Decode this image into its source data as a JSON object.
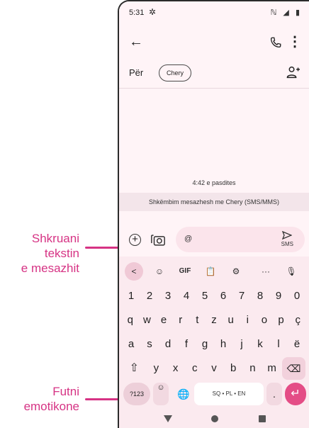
{
  "callouts": {
    "compose": [
      "Shkruani",
      "tekstin",
      "e mesazhit"
    ],
    "emoji": [
      "Futni",
      "emotikone"
    ]
  },
  "status": {
    "time": "5:31",
    "settings_icon": "gear-icon",
    "icons": "ℕ ◢ ▮"
  },
  "appbar": {
    "back_icon": "arrow-left-icon",
    "call_icon": "phone-icon",
    "more_icon": "more-vert-icon"
  },
  "to_row": {
    "label": "Për",
    "contact": "Chery",
    "add_icon": "add-person-icon"
  },
  "conversation": {
    "timestamp": "4:42 e pasdites",
    "info": "Shkëmbim mesazhesh me Chery (SMS/MMS)"
  },
  "compose": {
    "text": "@",
    "send_label": "SMS"
  },
  "keyboard": {
    "toolbar": [
      "<",
      "☺",
      "GIF",
      "📋",
      "⚙",
      "···",
      "🎙"
    ],
    "row1": [
      "1",
      "2",
      "3",
      "4",
      "5",
      "6",
      "7",
      "8",
      "9",
      "0"
    ],
    "row2": [
      "q",
      "w",
      "e",
      "r",
      "t",
      "z",
      "u",
      "i",
      "o",
      "p",
      "ç"
    ],
    "row3": [
      "a",
      "s",
      "d",
      "f",
      "g",
      "h",
      "j",
      "k",
      "l",
      "ë"
    ],
    "row4": [
      "y",
      "x",
      "c",
      "v",
      "b",
      "n",
      "m"
    ],
    "shift": "⇧",
    "backspace": "⌫",
    "numeric": "?123",
    "emoji_key": "☺",
    "globe": "🌐",
    "space": "SQ • PL • EN",
    "period": ".",
    "enter": "↵"
  },
  "colors": {
    "accent": "#d63384",
    "phone_bg": "#fff4f7",
    "keyboard_bg": "#fbeaef"
  }
}
